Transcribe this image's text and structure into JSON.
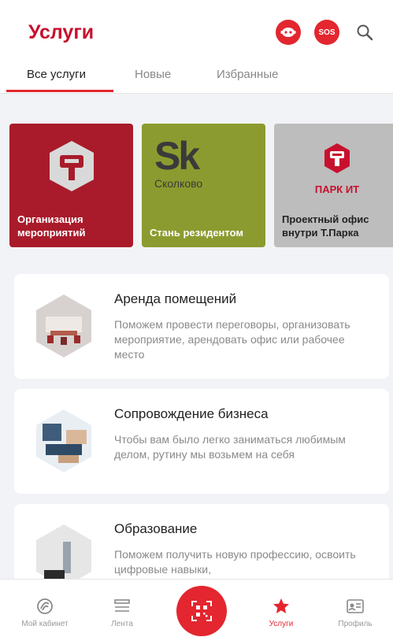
{
  "header": {
    "title": "Услуги",
    "sos_label": "SOS"
  },
  "tabs": [
    {
      "label": "Все услуги",
      "active": true
    },
    {
      "label": "Новые",
      "active": false
    },
    {
      "label": "Избранные",
      "active": false
    }
  ],
  "tiles": [
    {
      "label": "Организация мероприятий",
      "color": "#a91b2a",
      "icon": "technopark-logo-icon"
    },
    {
      "label": "Стань резидентом",
      "color": "#8c9b2f",
      "brand": "Sk",
      "brand_sub": "Сколково",
      "icon": "skolkovo-logo-icon"
    },
    {
      "label": "Проектный офис внутри Т.Парка",
      "color": "#bdbdbd",
      "brand": "ПАРК ИТ",
      "icon": "park-it-logo-icon"
    }
  ],
  "cards": [
    {
      "title": "Аренда помещений",
      "description": "Поможем провести переговоры, организовать мероприятие, арендовать офис или рабочее место"
    },
    {
      "title": "Сопровождение бизнеса",
      "description": "Чтобы вам было легко заниматься любимым делом, рутину мы возьмем на себя"
    },
    {
      "title": "Образование",
      "description": "Поможем получить новую профессию, освоить цифровые навыки,"
    }
  ],
  "nav": [
    {
      "label": "Мой кабинет",
      "icon": "cabinet-icon"
    },
    {
      "label": "Лента",
      "icon": "feed-icon"
    },
    {
      "label": "Услуги",
      "icon": "star-icon",
      "active": true
    },
    {
      "label": "Профиль",
      "icon": "profile-icon"
    }
  ],
  "colors": {
    "accent": "#e3262f",
    "title": "#c8102e"
  }
}
